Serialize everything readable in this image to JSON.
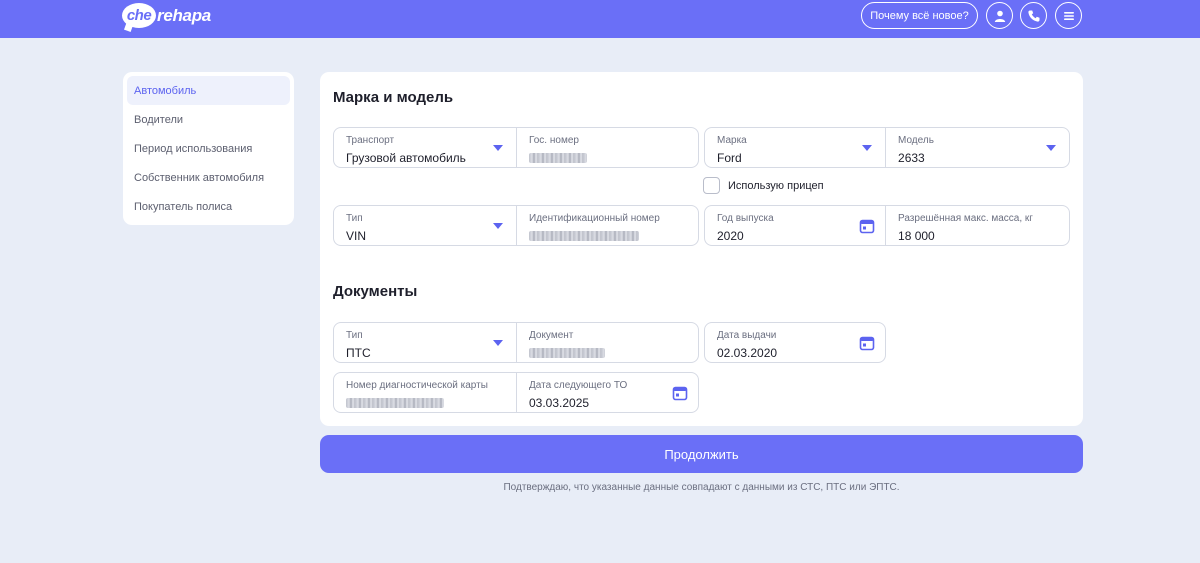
{
  "header": {
    "logo_bubble": "che",
    "logo_text": "rehapa",
    "why_new_label": "Почему всё новое?"
  },
  "sidebar": {
    "items": [
      {
        "label": "Автомобиль",
        "active": true
      },
      {
        "label": "Водители"
      },
      {
        "label": "Период использования"
      },
      {
        "label": "Собственник автомобиля"
      },
      {
        "label": "Покупатель полиса"
      }
    ]
  },
  "vehicle": {
    "title": "Марка и модель",
    "transport": {
      "label": "Транспорт",
      "value": "Грузовой автомобиль"
    },
    "plate": {
      "label": "Гос. номер"
    },
    "brand": {
      "label": "Марка",
      "value": "Ford"
    },
    "model": {
      "label": "Модель",
      "value": "2633"
    },
    "trailer_label": "Использую прицеп",
    "id_type": {
      "label": "Тип",
      "value": "VIN"
    },
    "id_number": {
      "label": "Идентификационный номер"
    },
    "year": {
      "label": "Год выпуска",
      "value": "2020"
    },
    "max_mass": {
      "label": "Разрешённая макс. масса, кг",
      "value": "18 000"
    }
  },
  "documents": {
    "title": "Документы",
    "doc_type": {
      "label": "Тип",
      "value": "ПТС"
    },
    "doc_number": {
      "label": "Документ"
    },
    "issue_date": {
      "label": "Дата выдачи",
      "value": "02.03.2020"
    },
    "diag_card": {
      "label": "Номер диагностической карты"
    },
    "next_to": {
      "label": "Дата следующего ТО",
      "value": "03.03.2025"
    }
  },
  "actions": {
    "continue_label": "Продолжить",
    "confirm_text": "Подтверждаю, что указанные данные совпадают с данными из СТС, ПТС или ЭПТС."
  },
  "colors": {
    "accent": "#6a6ff7",
    "page_bg": "#e8edf7",
    "card_bg": "#ffffff"
  },
  "icons": {
    "user": "user-icon",
    "phone": "phone-icon",
    "menu": "menu-icon",
    "dropdown": "chevron-down-icon",
    "calendar": "calendar-icon"
  }
}
